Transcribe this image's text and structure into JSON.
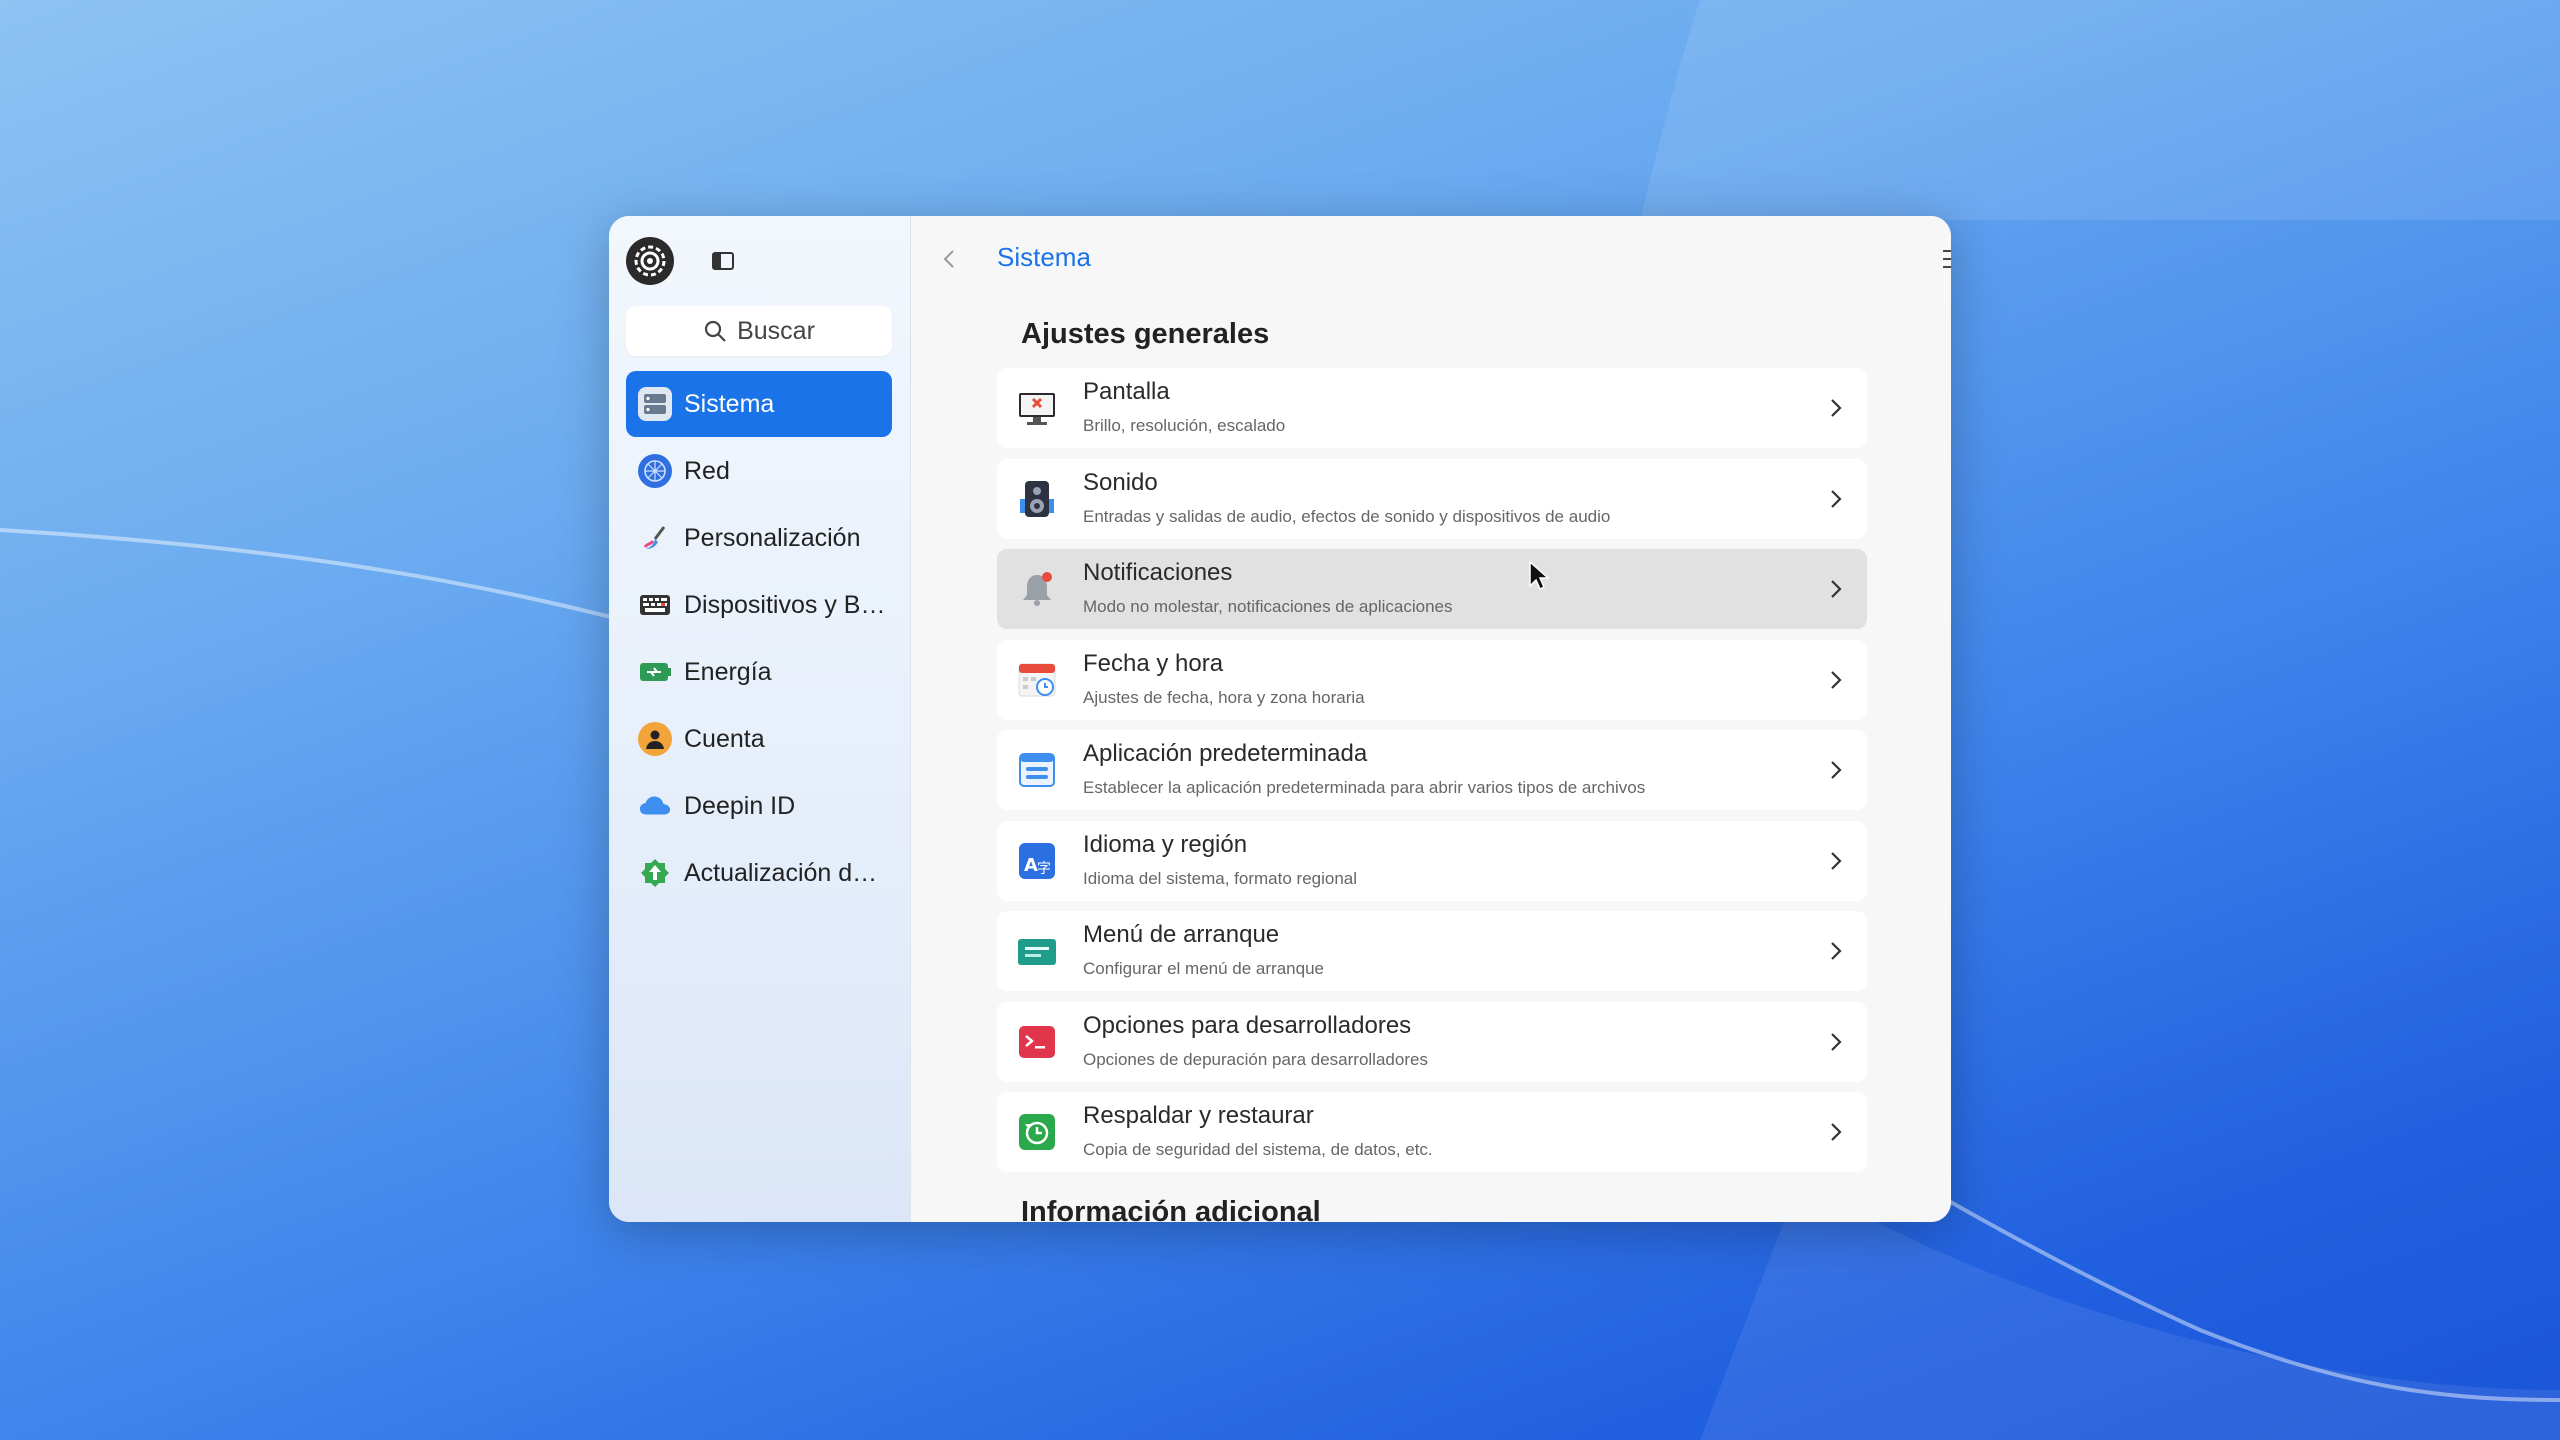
{
  "sidebar": {
    "search_placeholder": "Buscar",
    "items": [
      {
        "label": "Sistema",
        "icon": "system-icon",
        "active": true
      },
      {
        "label": "Red",
        "icon": "network-icon"
      },
      {
        "label": "Personalización",
        "icon": "personalization-icon"
      },
      {
        "label": "Dispositivos y B…",
        "icon": "devices-icon"
      },
      {
        "label": "Energía",
        "icon": "power-icon"
      },
      {
        "label": "Cuenta",
        "icon": "account-icon"
      },
      {
        "label": "Deepin ID",
        "icon": "cloud-icon"
      },
      {
        "label": "Actualización d…",
        "icon": "update-icon"
      }
    ]
  },
  "header": {
    "title": "Sistema"
  },
  "main": {
    "section_general": "Ajustes generales",
    "section_additional": "Información adicional",
    "rows": [
      {
        "title": "Pantalla",
        "subtitle": "Brillo, resolución, escalado",
        "icon": "display-icon"
      },
      {
        "title": "Sonido",
        "subtitle": "Entradas y salidas de audio, efectos de sonido y dispositivos de audio",
        "icon": "speaker-icon"
      },
      {
        "title": "Notificaciones",
        "subtitle": "Modo no molestar, notificaciones de aplicaciones",
        "icon": "bell-icon",
        "hover": true
      },
      {
        "title": "Fecha y hora",
        "subtitle": "Ajustes de fecha, hora y zona horaria",
        "icon": "calendar-icon"
      },
      {
        "title": "Aplicación predeterminada",
        "subtitle": "Establecer la aplicación predeterminada para abrir varios tipos de archivos",
        "icon": "default-app-icon"
      },
      {
        "title": "Idioma y región",
        "subtitle": "Idioma del sistema, formato regional",
        "icon": "language-icon"
      },
      {
        "title": "Menú de arranque",
        "subtitle": "Configurar el menú de arranque",
        "icon": "boot-menu-icon"
      },
      {
        "title": "Opciones para desarrolladores",
        "subtitle": "Opciones de depuración para desarrolladores",
        "icon": "terminal-icon"
      },
      {
        "title": "Respaldar y restaurar",
        "subtitle": "Copia de seguridad del sistema, de datos, etc.",
        "icon": "backup-icon"
      }
    ]
  },
  "colors": {
    "accent": "#1a73e8",
    "hover_row": "#e1e1e1"
  }
}
